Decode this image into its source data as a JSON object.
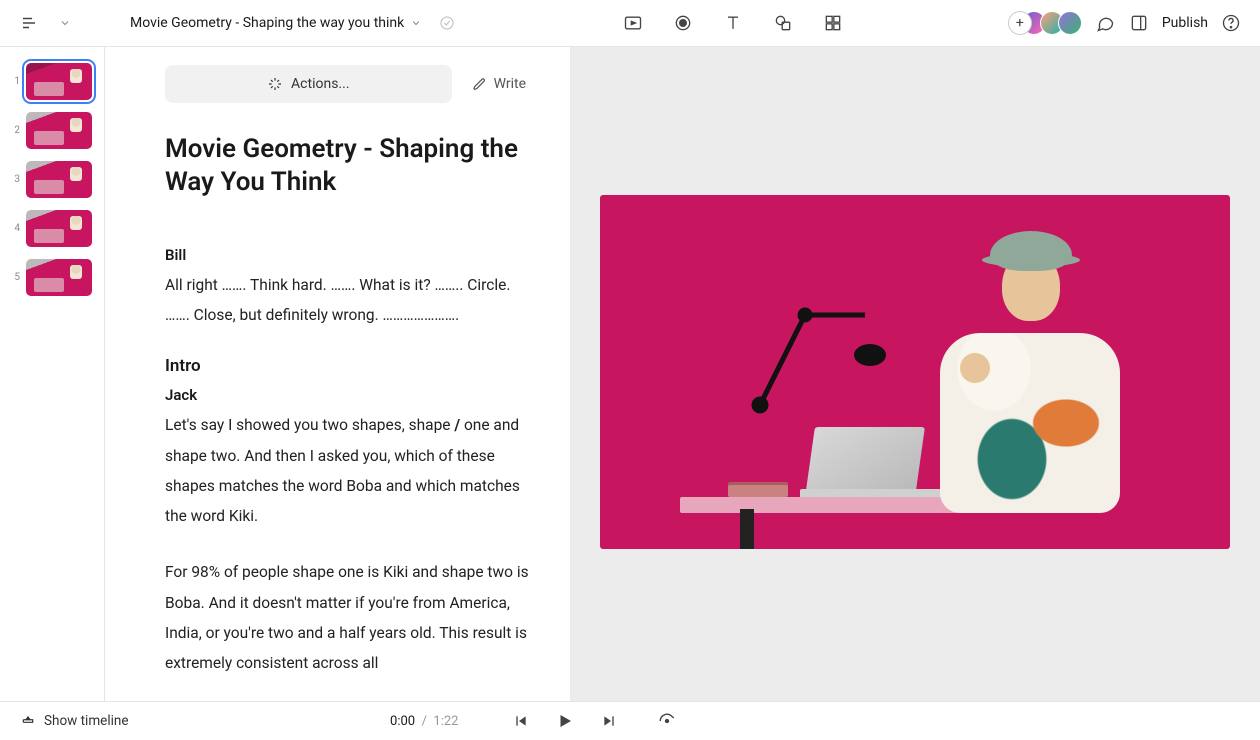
{
  "header": {
    "doc_title": "Movie Geometry - Shaping the way you think",
    "publish_label": "Publish"
  },
  "sidebar": {
    "thumbs": [
      "1",
      "2",
      "3",
      "4",
      "5"
    ],
    "selected_index": 0
  },
  "script": {
    "actions_label": "Actions...",
    "write_label": "Write",
    "title": "Movie Geometry - Shaping the Way You Think",
    "block1_speaker": "Bill",
    "block1_text": "All right ……. Think hard. ……. What is it? …….. Circle. ……. Close, but definitely wrong. ………………….",
    "section2_heading": "Intro",
    "block2_speaker": "Jack",
    "block2_text_a": "Let's say I showed you two shapes, shape ",
    "block2_slash": "/",
    "block2_text_b": " one and shape two. And then I asked you, which of these shapes matches the word Boba and which matches the word Kiki.",
    "block3_text": "For 98% of people shape one is Kiki and shape two is Boba. And it doesn't matter if you're from America, India, or you're two and a half years old. This result is extremely consistent across all"
  },
  "playback": {
    "show_timeline_label": "Show timeline",
    "current_time": "0:00",
    "separator": "/",
    "total_time": "1:22"
  }
}
